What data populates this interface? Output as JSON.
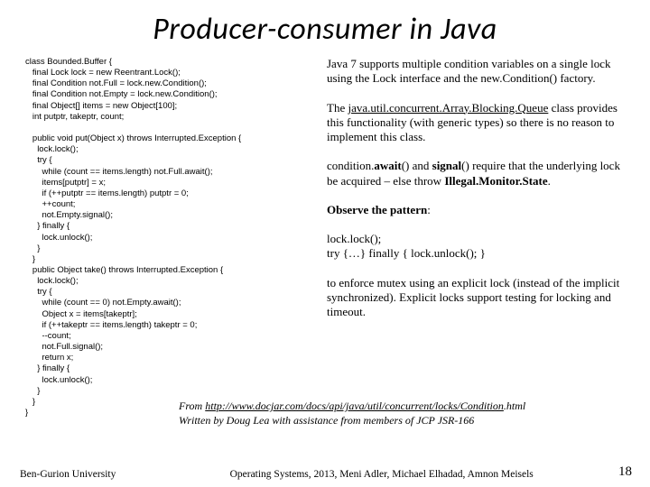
{
  "title": "Producer-consumer in Java",
  "code": "class Bounded.Buffer {\n   final Lock lock = new Reentrant.Lock();\n   final Condition not.Full = lock.new.Condition();\n   final Condition not.Empty = lock.new.Condition();\n   final Object[] items = new Object[100];\n   int putptr, takeptr, count;\n\n   public void put(Object x) throws Interrupted.Exception {\n     lock.lock();\n     try {\n       while (count == items.length) not.Full.await();\n       items[putptr] = x;\n       if (++putptr == items.length) putptr = 0;\n       ++count;\n       not.Empty.signal();\n     } finally {\n       lock.unlock();\n     }\n   }\n   public Object take() throws Interrupted.Exception {\n     lock.lock();\n     try {\n       while (count == 0) not.Empty.await();\n       Object x = items[takeptr];\n       if (++takeptr == items.length) takeptr = 0;\n       --count;\n       not.Full.signal();\n       return x;\n     } finally {\n       lock.unlock();\n     }\n   }\n}",
  "right": {
    "p1": "Java 7 supports multiple condition variables on a single lock using the Lock interface and the new.Condition() factory.",
    "p2_pre": "The ",
    "p2_u": "java.util.concurrent.Array.Blocking.Queue",
    "p2_post": " class provides this functionality (with generic types) so there is no reason to implement this class.",
    "p3_a": "condition.",
    "p3_b1": "await",
    "p3_b": "() and ",
    "p3_b2": "signal",
    "p3_c": "() require that the underlying lock be acquired – else throw ",
    "p3_b3": "Illegal.Monitor.State",
    "p3_d": ".",
    "p4_a": "Observe the pattern",
    "p4_b": ":",
    "p5": "lock.lock();\ntry {…} finally { lock.unlock(); }",
    "p6": "to enforce mutex using an explicit lock (instead of the implicit synchronized). Explicit locks support testing for locking and timeout."
  },
  "cite": {
    "pre": "From ",
    "link": "http://www.docjar.com/docs/api/java/util/concurrent/locks/Condition",
    "post": ".html",
    "line2": "Written by Doug Lea with assistance from members of JCP JSR-166"
  },
  "footer": {
    "left": "Ben-Gurion University",
    "mid": "Operating Systems, 2013, Meni Adler, Michael Elhadad, Amnon Meisels",
    "right": "18"
  }
}
